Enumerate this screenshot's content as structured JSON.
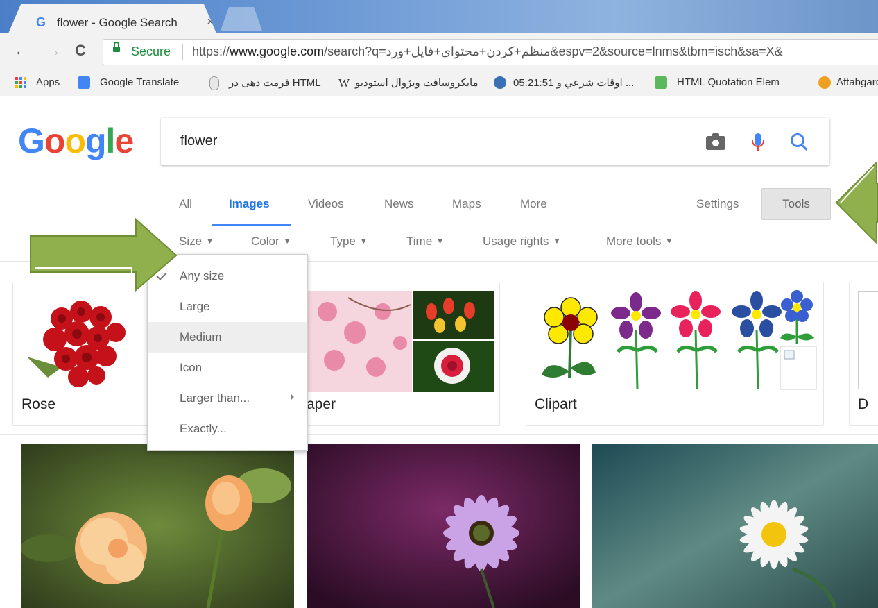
{
  "browser": {
    "tab_title": "flower - Google Search",
    "tab_close": "×",
    "favicon": "G",
    "secure_label": "Secure",
    "url_scheme": "https://",
    "url_host": "www.google.com",
    "url_path": "/search?q=منظم+کردن+محتوای+فایل+ورد&espv=2&source=lnms&tbm=isch&sa=X&",
    "nav": {
      "back": "←",
      "forward": "→",
      "reload": "C"
    }
  },
  "bookmarks": [
    {
      "label": "Apps"
    },
    {
      "label": "Google Translate"
    },
    {
      "label": "فرمت دهی در HTML"
    },
    {
      "label": "مایکروسافت ویژوال استودیو"
    },
    {
      "label": "05:21:51 اوقات شرعي و ..."
    },
    {
      "label": "HTML Quotation Elem"
    },
    {
      "label": "Aftabgardan"
    }
  ],
  "search": {
    "logo": [
      "G",
      "o",
      "o",
      "g",
      "l",
      "e"
    ],
    "logo_colors": [
      "#4285f4",
      "#ea4335",
      "#fbbc05",
      "#4285f4",
      "#34a853",
      "#ea4335"
    ],
    "query": "flower"
  },
  "tabs": [
    {
      "label": "All"
    },
    {
      "label": "Images",
      "active": true
    },
    {
      "label": "Videos"
    },
    {
      "label": "News"
    },
    {
      "label": "Maps"
    },
    {
      "label": "More"
    }
  ],
  "settings_label": "Settings",
  "tools_label": "Tools",
  "tools": [
    {
      "label": "Size"
    },
    {
      "label": "Color"
    },
    {
      "label": "Type"
    },
    {
      "label": "Time"
    },
    {
      "label": "Usage rights"
    },
    {
      "label": "More tools"
    }
  ],
  "size_menu": {
    "items": [
      {
        "label": "Any size",
        "checked": true
      },
      {
        "label": "Large"
      },
      {
        "label": "Medium",
        "highlighted": true
      },
      {
        "label": "Icon"
      },
      {
        "label": "Larger than...",
        "has_submenu": true
      },
      {
        "label": "Exactly..."
      }
    ]
  },
  "cards": [
    {
      "label": "Rose"
    },
    {
      "label": "aper"
    },
    {
      "label": "Clipart"
    },
    {
      "label": "D"
    }
  ],
  "colors": {
    "accent": "#4285f4",
    "arrow": "#8fb04c"
  }
}
